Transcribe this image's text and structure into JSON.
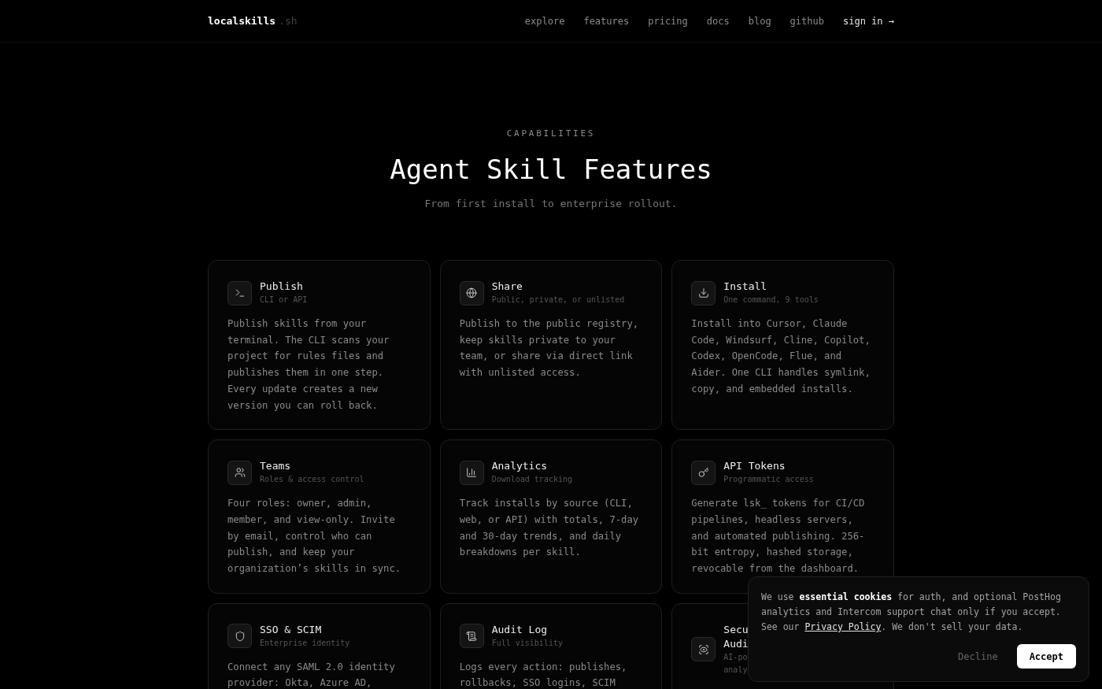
{
  "nav": {
    "logo": "localskills",
    "logo_suffix": ".sh",
    "links": [
      "explore",
      "features",
      "pricing",
      "docs",
      "blog",
      "github"
    ],
    "cta": "sign in →"
  },
  "hero": {
    "eyebrow": "CAPABILITIES",
    "title": "Agent Skill Features",
    "subtitle": "From first install to enterprise rollout."
  },
  "features": [
    {
      "title": "Publish",
      "subtitle": "CLI or API",
      "body": "Publish skills from your terminal. The CLI scans your project for rules files and publishes them in one step. Every update creates a new version you can roll back."
    },
    {
      "title": "Share",
      "subtitle": "Public, private, or unlisted",
      "body": "Publish to the public registry, keep skills private to your team, or share via direct link with unlisted access."
    },
    {
      "title": "Install",
      "subtitle": "One command, 9 tools",
      "body": "Install into Cursor, Claude Code, Windsurf, Cline, Copilot, Codex, OpenCode, Flue, and Aider. One CLI handles symlink, copy, and embedded installs."
    },
    {
      "title": "Teams",
      "subtitle": "Roles & access control",
      "body": "Four roles: owner, admin, member, and view-only. Invite by email, control who can publish, and keep your organization’s skills in sync."
    },
    {
      "title": "Analytics",
      "subtitle": "Download tracking",
      "body": "Track installs by source (CLI, web, or API) with totals, 7-day and 30-day trends, and daily breakdowns per skill."
    },
    {
      "title": "API Tokens",
      "subtitle": "Programmatic access",
      "body": "Generate lsk_ tokens for CI/CD pipelines, headless servers, and automated publishing. 256-bit entropy, hashed storage, revocable from the dashboard."
    },
    {
      "title": "SSO & SCIM",
      "subtitle": "Enterprise identity",
      "body": "Connect any SAML 2.0 identity provider: Okta, Azure AD,"
    },
    {
      "title": "Audit Log",
      "subtitle": "Full visibility",
      "body": "Logs every action: publishes, rollbacks, SSO logins, SCIM"
    },
    {
      "title": "Secu\nAudi",
      "subtitle": "AI-po\nanaly"
    }
  ],
  "cookie_banner": {
    "text": "We use **essential cookies** for auth, and optional PostHog analytics and Intercom support chat only if you accept. See our",
    "link": "Privacy Policy",
    "text_after": ". We don't sell your data.",
    "decline": "Decline",
    "accept": "Accept"
  }
}
